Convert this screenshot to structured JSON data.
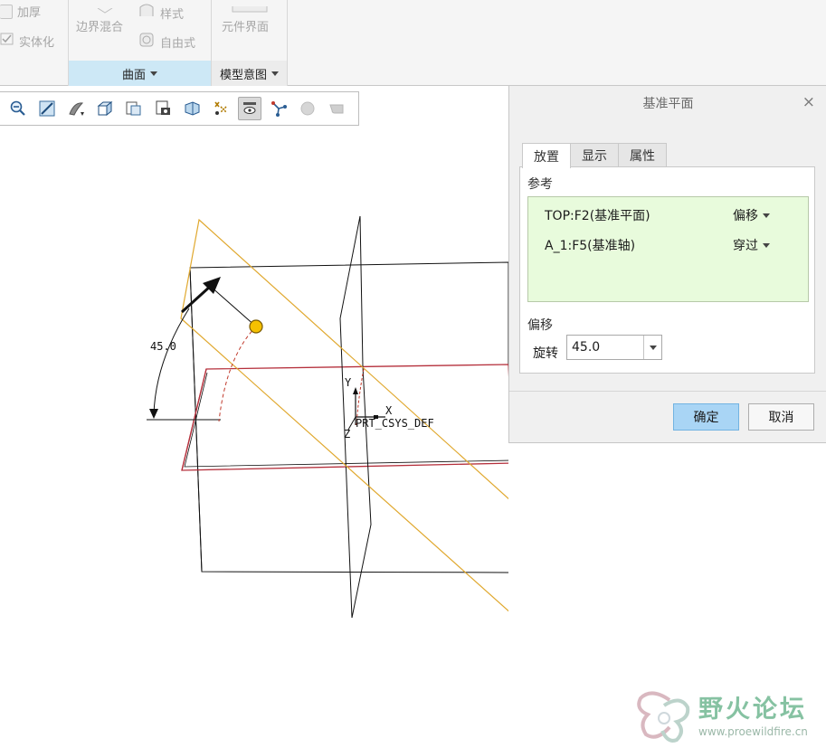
{
  "ribbon": {
    "items": {
      "thicken": "加厚",
      "solidify": "实体化",
      "boundary_blend": "边界混合",
      "style": "样式",
      "freestyle": "自由式",
      "component_interface": "元件界面"
    },
    "groups": {
      "surfaces": "曲面",
      "model_intent": "模型意图"
    },
    "colors": {
      "active_group": "#cde8f6",
      "disabled_text": "#a6a6a6"
    }
  },
  "graphics_toolbar": {
    "icons": [
      "zoom-out-icon",
      "refit-icon",
      "repaint-icon",
      "view-orientation-icon",
      "saved-views-icon",
      "display-style-icon",
      "perspective-icon",
      "datum-display-icon",
      "annotation-display-icon",
      "spin-center-icon",
      "sphere-icon",
      "render-icon"
    ]
  },
  "canvas": {
    "angle_label": "45.0",
    "csys_label": "PRT_CSYS_DEF",
    "axis_x": "X",
    "axis_y": "Y",
    "axis_z": "Z",
    "colors": {
      "new_plane": "#e0a82e",
      "selected_plane": "#b5303c",
      "handle": "#f5c000"
    }
  },
  "dialog": {
    "title": "基准平面",
    "close_glyph": "×",
    "tabs": [
      "放置",
      "显示",
      "属性"
    ],
    "references_label": "参考",
    "references": [
      {
        "name": "TOP:F2(基准平面)",
        "mode": "偏移"
      },
      {
        "name": "A_1:F5(基准轴)",
        "mode": "穿过"
      }
    ],
    "offset_label": "偏移",
    "rotation_label": "旋转",
    "rotation_value": "45.0",
    "ok": "确定",
    "cancel": "取消",
    "colors": {
      "reference_bg": "#e8fbdc",
      "ok_bg": "#a9d5f5"
    }
  },
  "watermark": {
    "title": "野火论坛",
    "url": "www.proewildfire.cn"
  }
}
